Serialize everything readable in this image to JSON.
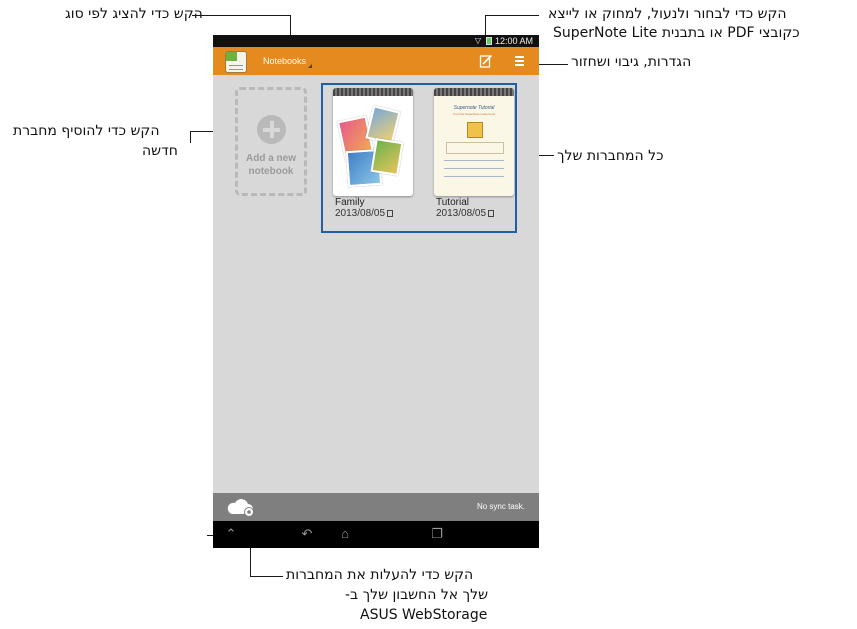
{
  "callouts": {
    "filter": "הקש כדי להציג לפי סוג",
    "select_line1": "הקש כדי לבחור ולנעול, למחוק או לייצא",
    "select_line2": "כקובצי PDF או בתבנית SuperNote Lite",
    "settings": "הגדרות, גיבוי ושחזור",
    "add_line1": "הקש כדי להוסיף מחברת",
    "add_line2": "חדשה",
    "all_notebooks": "כל המחברות שלך",
    "upload_line1": "הקש כדי להעלות את המחברות",
    "upload_line2": "שלך אל החשבון שלך ב-",
    "upload_line3": "ASUS WebStorage"
  },
  "status_bar": {
    "time": "12:00 AM",
    "wifi": "wifi-icon",
    "battery": "battery-icon"
  },
  "app_bar": {
    "title": "Notebooks",
    "icons": [
      "supernote-app-icon",
      "edit-select-icon",
      "menu-icon"
    ],
    "color": "#e58a1f"
  },
  "add_notebook": {
    "label": "Add a new notebook",
    "icon": "plus-icon"
  },
  "notebooks": [
    {
      "name": "Family",
      "date": "2013/08/05"
    },
    {
      "name": "Tutorial",
      "date": "2013/08/05",
      "cover_title": "Supernote Tutorial",
      "cover_subtitle": "Your first SuperNote notes here!"
    }
  ],
  "bottom_bar": {
    "sync_text": "No sync task.",
    "icon": "cloud-sync-icon"
  },
  "system_nav": [
    "home-up-icon",
    "back-icon",
    "home-icon",
    "recent-apps-icon"
  ],
  "colors": {
    "highlight_border": "#1f5fa8",
    "screen_bg": "#d8d8d8",
    "bottom_bar": "#7f7f7f"
  }
}
